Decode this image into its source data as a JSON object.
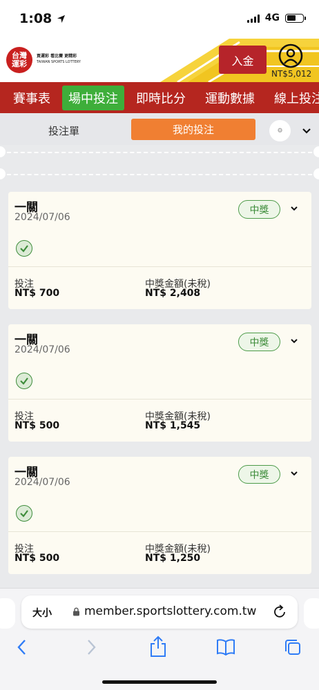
{
  "status_bar": {
    "time": "1:08",
    "network": "4G"
  },
  "header": {
    "logo_text": "台灣運彩",
    "logo_tagline": "買運彩 看比賽 更精彩",
    "logo_subtitle": "TAIWAN SPORTS LOTTERY",
    "deposit_label": "入金",
    "balance": "NT$5,012"
  },
  "nav": {
    "items": [
      "賽事表",
      "場中投注",
      "即時比分",
      "運動數據",
      "線上投注"
    ],
    "active_index": 1
  },
  "tabs": {
    "slip_label": "投注單",
    "my_bets_label": "我的投注"
  },
  "bets": [
    {
      "type": "一關",
      "date": "2024/07/06",
      "status": "中獎",
      "stake_label": "投注",
      "stake": "NT$ 700",
      "payout_label": "中獎金額(未稅)",
      "payout": "NT$ 2,408"
    },
    {
      "type": "一關",
      "date": "2024/07/06",
      "status": "中獎",
      "stake_label": "投注",
      "stake": "NT$ 500",
      "payout_label": "中獎金額(未稅)",
      "payout": "NT$ 1,545"
    },
    {
      "type": "一關",
      "date": "2024/07/06",
      "status": "中獎",
      "stake_label": "投注",
      "stake": "NT$ 500",
      "payout_label": "中獎金額(未稅)",
      "payout": "NT$ 1,250"
    }
  ],
  "browser": {
    "text_size_label": "大小",
    "url": "member.sportslottery.com.tw"
  },
  "colors": {
    "brand_red": "#b5261f",
    "active_green": "#3eae3a",
    "tab_orange": "#f07f32",
    "win_green": "#3b8b38"
  }
}
